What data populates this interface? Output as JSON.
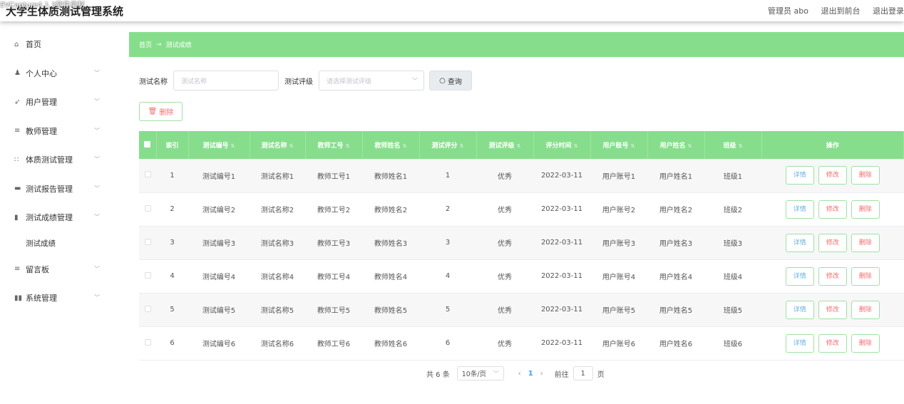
{
  "header": {
    "overlay_text": "EVCapture4.1.3软件录制",
    "title": "大学生体质测试管理系统",
    "admin": "管理员 abo",
    "frontend_link": "退出到前台",
    "logout_link": "退出登录"
  },
  "sidebar": {
    "items": [
      {
        "label": "首页",
        "icon": "home-icon",
        "glyph": "⌂"
      },
      {
        "label": "个人中心",
        "icon": "person-icon",
        "glyph": "♟"
      },
      {
        "label": "用户管理",
        "icon": "send-icon",
        "glyph": "➶"
      },
      {
        "label": "教师管理",
        "icon": "list-icon",
        "glyph": "≡"
      },
      {
        "label": "体质测试管理",
        "icon": "grid-icon",
        "glyph": "∷"
      },
      {
        "label": "测试报告管理",
        "icon": "monitor-icon",
        "glyph": "▬"
      },
      {
        "label": "测试成绩管理",
        "icon": "bookmark-icon",
        "glyph": "▮"
      },
      {
        "label": "留言板",
        "icon": "list-icon",
        "glyph": "≡"
      },
      {
        "label": "系统管理",
        "icon": "chart-icon",
        "glyph": "▮▮"
      }
    ],
    "sub_item": "测试成绩"
  },
  "breadcrumb": {
    "home": "首页",
    "arrow": "→",
    "current": "测试成绩"
  },
  "search": {
    "name_label": "测试名称",
    "name_placeholder": "测试名称",
    "level_label": "测试评级",
    "level_placeholder": "请选择测试评级",
    "query_button": "查询"
  },
  "delete_button": "删除",
  "table": {
    "headers": [
      "索引",
      "测试编号",
      "测试名称",
      "教师工号",
      "教师姓名",
      "测试评分",
      "测试评级",
      "评分时间",
      "用户账号",
      "用户姓名",
      "班级",
      "操作"
    ],
    "rows": [
      {
        "idx": "1",
        "code": "测试编号1",
        "name": "测试名称1",
        "tid": "教师工号1",
        "tname": "教师姓名1",
        "score": "1",
        "level": "优秀",
        "time": "2022-03-11",
        "account": "用户账号1",
        "uname": "用户姓名1",
        "cls": "班级1"
      },
      {
        "idx": "2",
        "code": "测试编号2",
        "name": "测试名称2",
        "tid": "教师工号2",
        "tname": "教师姓名2",
        "score": "2",
        "level": "优秀",
        "time": "2022-03-11",
        "account": "用户账号2",
        "uname": "用户姓名2",
        "cls": "班级2"
      },
      {
        "idx": "3",
        "code": "测试编号3",
        "name": "测试名称3",
        "tid": "教师工号3",
        "tname": "教师姓名3",
        "score": "3",
        "level": "优秀",
        "time": "2022-03-11",
        "account": "用户账号3",
        "uname": "用户姓名3",
        "cls": "班级3"
      },
      {
        "idx": "4",
        "code": "测试编号4",
        "name": "测试名称4",
        "tid": "教师工号4",
        "tname": "教师姓名4",
        "score": "4",
        "level": "优秀",
        "time": "2022-03-11",
        "account": "用户账号4",
        "uname": "用户姓名4",
        "cls": "班级4"
      },
      {
        "idx": "5",
        "code": "测试编号5",
        "name": "测试名称5",
        "tid": "教师工号5",
        "tname": "教师姓名5",
        "score": "5",
        "level": "优秀",
        "time": "2022-03-11",
        "account": "用户账号5",
        "uname": "用户姓名5",
        "cls": "班级5"
      },
      {
        "idx": "6",
        "code": "测试编号6",
        "name": "测试名称6",
        "tid": "教师工号6",
        "tname": "教师姓名6",
        "score": "6",
        "level": "优秀",
        "time": "2022-03-11",
        "account": "用户账号6",
        "uname": "用户姓名6",
        "cls": "班级6"
      }
    ],
    "actions": {
      "detail": "详情",
      "edit": "修改",
      "delete": "删除"
    }
  },
  "pagination": {
    "total": "共 6 条",
    "page_size": "10条/页",
    "prev": "‹",
    "current_page": "1",
    "next": "›",
    "goto_label": "前往",
    "goto_value": "1",
    "page_suffix": "页"
  },
  "colors": {
    "accent": "#86de8c",
    "danger": "#f56c6c",
    "link": "#67b3e0"
  }
}
